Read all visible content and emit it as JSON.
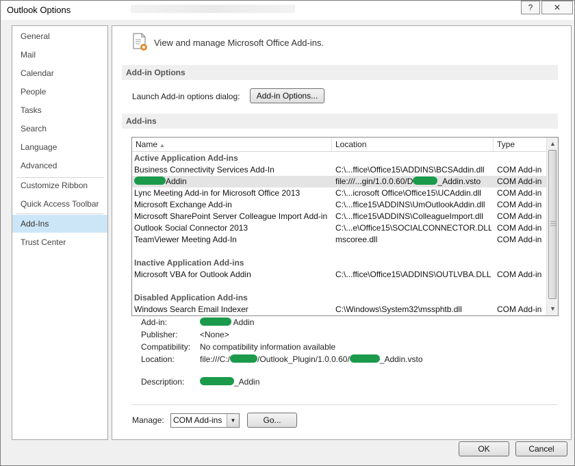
{
  "window": {
    "title": "Outlook Options",
    "help_glyph": "?",
    "close_glyph": "✕"
  },
  "sidebar": {
    "items": [
      {
        "label": "General"
      },
      {
        "label": "Mail"
      },
      {
        "label": "Calendar"
      },
      {
        "label": "People"
      },
      {
        "label": "Tasks"
      },
      {
        "label": "Search"
      },
      {
        "label": "Language"
      },
      {
        "label": "Advanced"
      },
      {
        "label": "Customize Ribbon"
      },
      {
        "label": "Quick Access Toolbar"
      },
      {
        "label": "Add-Ins",
        "selected": true
      },
      {
        "label": "Trust Center"
      }
    ]
  },
  "header": {
    "icon": "addins-page-icon",
    "text": "View and manage Microsoft Office Add-ins."
  },
  "addin_options": {
    "section_title": "Add-in Options",
    "launch_label": "Launch Add-in options dialog:",
    "button_label": "Add-in Options..."
  },
  "addins": {
    "section_title": "Add-ins",
    "columns": {
      "name": "Name",
      "location": "Location",
      "type": "Type",
      "name_sort_glyph": "▲"
    },
    "groups": [
      {
        "title": "Active Application Add-ins",
        "rows": [
          {
            "name": "Business Connectivity Services Add-In",
            "location": "C:\\...ffice\\Office15\\ADDINS\\BCSAddin.dll",
            "type": "COM Add-in"
          },
          {
            "name": "Addin",
            "location": "file:///...gin/1.0.0.60/D",
            "location_tail": "_Addin.vsto",
            "type": "COM Add-in",
            "redacted": true,
            "selected": true
          },
          {
            "name": "Lync Meeting Add-in for Microsoft Office 2013",
            "location": "C:\\...icrosoft Office\\Office15\\UCAddin.dll",
            "type": "COM Add-in"
          },
          {
            "name": "Microsoft Exchange Add-in",
            "location": "C:\\...ffice15\\ADDINS\\UmOutlookAddin.dll",
            "type": "COM Add-in"
          },
          {
            "name": "Microsoft SharePoint Server Colleague Import Add-in",
            "location": "C:\\...ffice15\\ADDINS\\ColleagueImport.dll",
            "type": "COM Add-in"
          },
          {
            "name": "Outlook Social Connector 2013",
            "location": "C:\\...e\\Office15\\SOCIALCONNECTOR.DLL",
            "type": "COM Add-in"
          },
          {
            "name": "TeamViewer Meeting Add-In",
            "location": "mscoree.dll",
            "type": "COM Add-in"
          }
        ]
      },
      {
        "title": "Inactive Application Add-ins",
        "rows": [
          {
            "name": "Microsoft VBA for Outlook Addin",
            "location": "C:\\...ffice\\Office15\\ADDINS\\OUTLVBA.DLL",
            "type": "COM Add-in"
          }
        ]
      },
      {
        "title": "Disabled Application Add-ins",
        "rows": [
          {
            "name": "Windows Search Email Indexer",
            "location": "C:\\Windows\\System32\\mssphtb.dll",
            "type": "COM Add-in"
          }
        ]
      }
    ],
    "scroll_up_glyph": "▲",
    "scroll_down_glyph": "▼"
  },
  "details": {
    "addin_label": "Add-in:",
    "addin_value": "Addin",
    "publisher_label": "Publisher:",
    "publisher_value": "<None>",
    "compat_label": "Compatibility:",
    "compat_value": "No compatibility information available",
    "location_label": "Location:",
    "location_prefix": "file:///C:/",
    "location_middle": "/Outlook_Plugin/1.0.0.60/",
    "location_suffix": "_Addin.vsto",
    "desc_label": "Description:",
    "desc_value": "_Addin"
  },
  "manage": {
    "label": "Manage:",
    "selected": "COM Add-ins",
    "go_label": "Go..."
  },
  "dialog_buttons": {
    "ok": "OK",
    "cancel": "Cancel"
  }
}
